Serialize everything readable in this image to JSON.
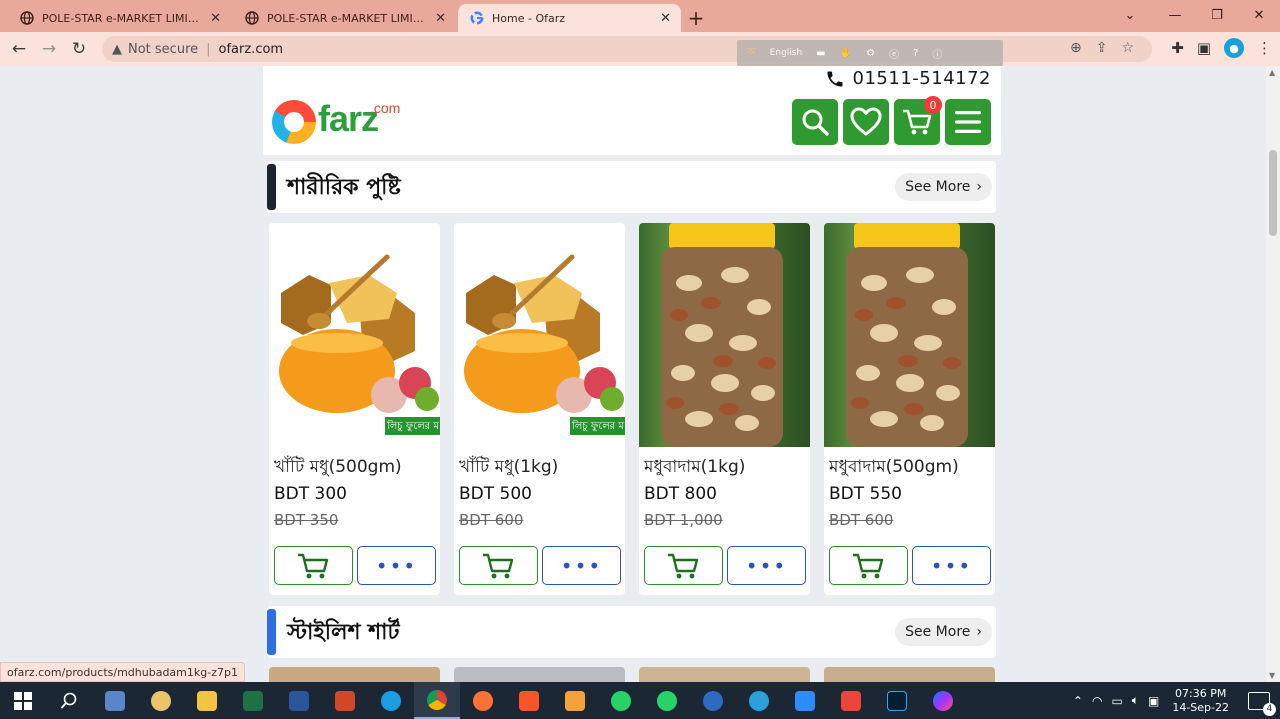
{
  "browser": {
    "tabs": [
      {
        "title": "POLE-STAR e-MARKET LIMITED -",
        "favicon": "globe-icon",
        "active": false
      },
      {
        "title": "POLE-STAR e-MARKET LIMITED -",
        "favicon": "globe-icon",
        "active": false
      },
      {
        "title": "Home - Ofarz",
        "favicon": "google-icon",
        "active": true
      }
    ],
    "new_tab_label": "+",
    "address": {
      "security_label": "Not secure",
      "url": "ofarz.com"
    },
    "extension_bar": {
      "language": "English"
    },
    "status_url": "ofarz.com/products/mdhubadam1kg-z7p1"
  },
  "site": {
    "phone": "01511-514172",
    "logo": {
      "word": "farz",
      "suffix": ".com"
    },
    "cart_count": "0",
    "accent": "#2f9a2f"
  },
  "sections": [
    {
      "title": "শারীরিক পুষ্টি",
      "see_more": "See More",
      "accent": "#1b2431",
      "products": [
        {
          "name": "খাঁটি মধু(500gm)",
          "price": "BDT 300",
          "old_price": "BDT 350",
          "image": "honey",
          "tag": "লিচু ফুলের ম"
        },
        {
          "name": "খাঁটি মধু(1kg)",
          "price": "BDT 500",
          "old_price": "BDT 600",
          "image": "honey",
          "tag": "লিচু ফুলের ম"
        },
        {
          "name": "মধুবাদাম(1kg)",
          "price": "BDT 800",
          "old_price": "BDT 1,000",
          "image": "nuts"
        },
        {
          "name": "মধুবাদাম(500gm)",
          "price": "BDT 550",
          "old_price": "BDT 600",
          "image": "nuts"
        }
      ]
    },
    {
      "title": "স্টাইলিশ শার্ট",
      "see_more": "See More",
      "accent": "#2c6fe0"
    }
  ],
  "taskbar": {
    "time": "07:36 PM",
    "date": "14-Sep-22",
    "notifications": "4"
  }
}
